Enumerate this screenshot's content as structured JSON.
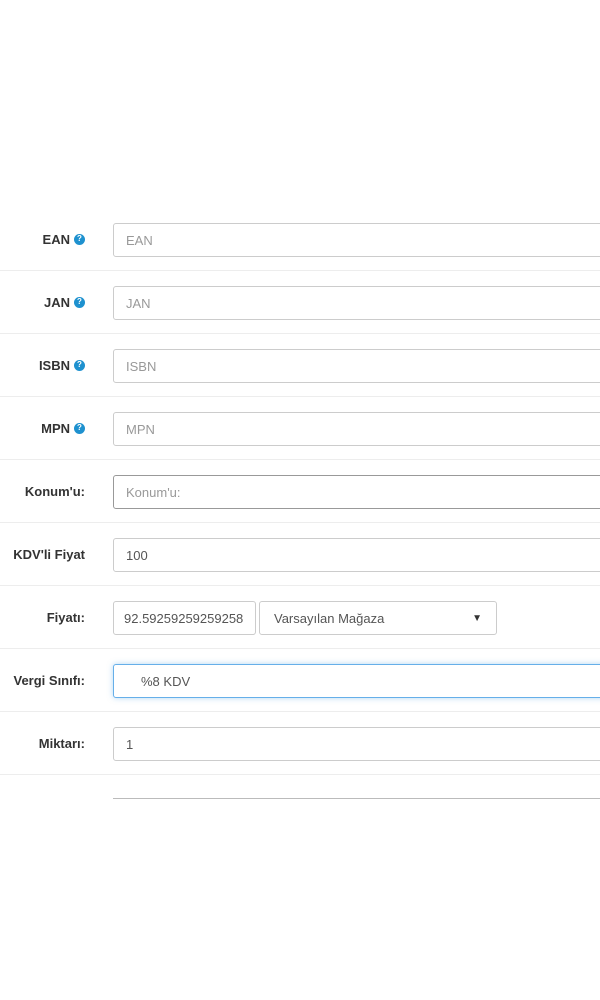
{
  "fields": {
    "ean": {
      "label": "EAN",
      "placeholder": "EAN",
      "value": ""
    },
    "jan": {
      "label": "JAN",
      "placeholder": "JAN",
      "value": ""
    },
    "isbn": {
      "label": "ISBN",
      "placeholder": "ISBN",
      "value": ""
    },
    "mpn": {
      "label": "MPN",
      "placeholder": "MPN",
      "value": ""
    },
    "location": {
      "label": "Konum'u:",
      "placeholder": "Konum'u:",
      "value": ""
    },
    "price_incl_vat": {
      "label": "KDV'li Fiyat",
      "value": "100"
    },
    "price": {
      "label": "Fiyatı:",
      "value": "92.59259259259258",
      "store_select": "Varsayılan Mağaza"
    },
    "tax_class": {
      "label": "Vergi Sınıfı:",
      "value": "%8 KDV"
    },
    "quantity": {
      "label": "Miktarı:",
      "value": "1"
    }
  },
  "help_icon_glyph": "?",
  "caret_glyph": "▼",
  "colors": {
    "help_icon": "#1e91cf",
    "focus_border": "#66afe9",
    "row_divider": "#ededed"
  }
}
